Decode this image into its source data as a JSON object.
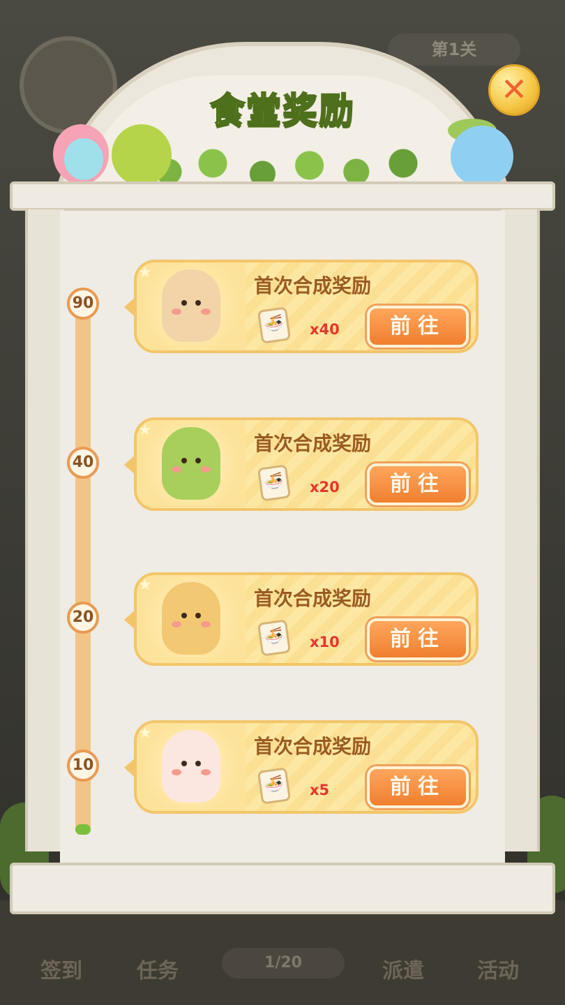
{
  "modal": {
    "title": "食堂奖励",
    "close_icon": "close-x-icon"
  },
  "background": {
    "level_label": "第1关",
    "progress_text": "1/20",
    "nav_items": [
      "签到",
      "任务",
      "派遣",
      "活动"
    ]
  },
  "slider": {
    "ticks": [
      "90",
      "40",
      "20",
      "10"
    ],
    "progress_fraction": 0.02
  },
  "rewards": [
    {
      "title": "首次合成奖励",
      "quantity": "x40",
      "button": "前往",
      "creature": "rabbit-chef",
      "body_color": "#f2d4a8"
    },
    {
      "title": "首次合成奖励",
      "quantity": "x20",
      "button": "前往",
      "creature": "green-dino",
      "body_color": "#a8cf5c"
    },
    {
      "title": "首次合成奖励",
      "quantity": "x10",
      "button": "前往",
      "creature": "lion-cub",
      "body_color": "#f3c873"
    },
    {
      "title": "首次合成奖励",
      "quantity": "x5",
      "button": "前往",
      "creature": "rooster",
      "body_color": "#fbe7df"
    }
  ],
  "colors": {
    "title_green": "#a8d34a",
    "button_orange": "#f07f2e",
    "quantity_red": "#e6362c"
  }
}
